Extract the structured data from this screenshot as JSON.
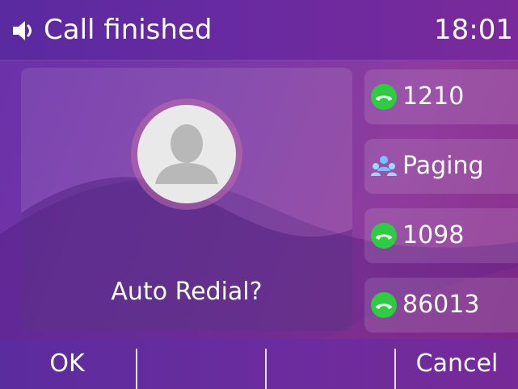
{
  "status_bar": {
    "icon": "speaker-icon",
    "title": "Call finished",
    "time": "18:01"
  },
  "call_panel": {
    "avatar_icon": "contact-avatar-icon",
    "prompt": "Auto Redial?"
  },
  "line_keys": [
    {
      "label": "1210",
      "icon": "green-handset-icon",
      "icon_color": "#2ecc40"
    },
    {
      "label": "Paging",
      "icon": "paging-group-icon",
      "icon_color": "#6ec6ff"
    },
    {
      "label": "1098",
      "icon": "green-handset-icon",
      "icon_color": "#2ecc40"
    },
    {
      "label": "86013",
      "icon": "green-handset-icon",
      "icon_color": "#2ecc40"
    }
  ],
  "soft_keys": [
    "OK",
    "",
    "",
    "Cancel"
  ],
  "colors": {
    "background": "#7a3aa6",
    "handset_green": "#2ecc40",
    "paging_blue": "#6ec6ff",
    "avatar_bg": "#e9e9ea",
    "avatar_figure": "#b8b8b8"
  }
}
